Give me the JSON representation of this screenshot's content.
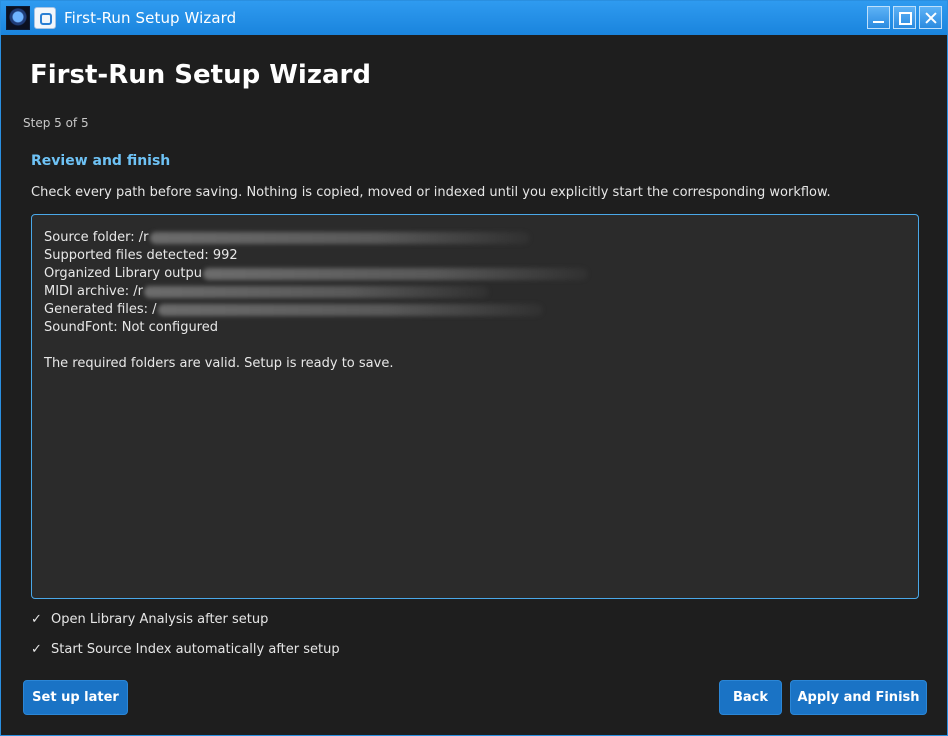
{
  "window": {
    "title": "First-Run Setup Wizard"
  },
  "page": {
    "heading": "First-Run Setup Wizard",
    "step": "Step 5 of 5",
    "section_title": "Review and finish",
    "description": "Check every path before saving. Nothing is copied, moved or indexed until you explicitly start the corresponding workflow."
  },
  "summary": {
    "source_folder": "Source folder: /r",
    "supported_files": "Supported files detected: 992",
    "organized_library": "Organized Library outpu",
    "midi_archive": "MIDI archive: /r",
    "generated_files": "Generated files: /",
    "soundfont": "SoundFont: Not configured",
    "status": "The required folders are valid. Setup is ready to save."
  },
  "options": {
    "open_library_analysis": {
      "label": "Open Library Analysis after setup",
      "checked": true,
      "mark": "✓"
    },
    "start_source_index": {
      "label": "Start Source Index automatically after setup",
      "checked": true,
      "mark": "✓"
    }
  },
  "buttons": {
    "setup_later": "Set up later",
    "back": "Back",
    "apply_finish": "Apply and Finish"
  },
  "colors": {
    "accent": "#1a73c5",
    "section_title": "#6ec2f5",
    "titlebar": "#2a8fe0"
  }
}
